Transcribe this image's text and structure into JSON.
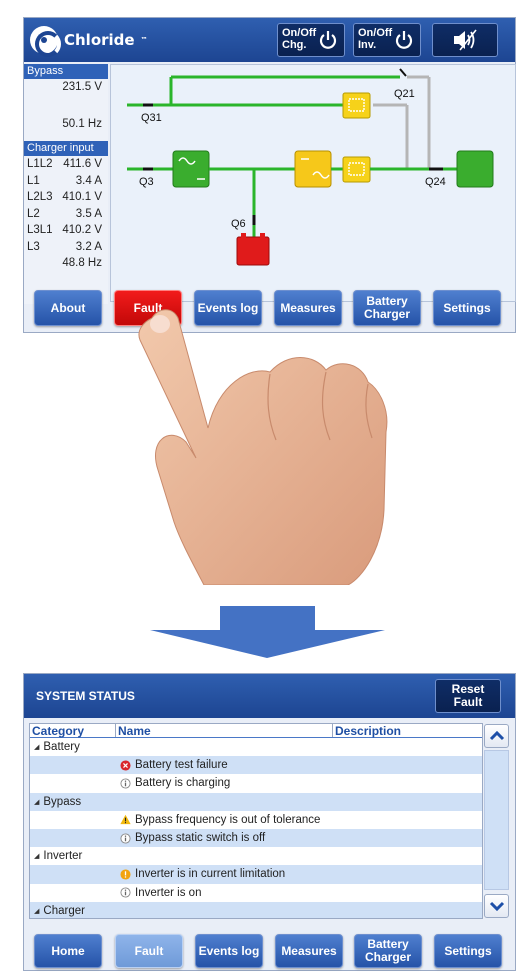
{
  "screen1": {
    "brand": "Chloride",
    "brand_tm": "™",
    "onoff_chg": "On/Off\nChg.",
    "onoff_chg_l1": "On/Off",
    "onoff_chg_l2": "Chg.",
    "onoff_inv_l1": "On/Off",
    "onoff_inv_l2": "Inv.",
    "bypass": {
      "header": "Bypass",
      "voltage": "231.5 V",
      "frequency": "50.1 Hz"
    },
    "charger_input": {
      "header": "Charger input",
      "rows": [
        {
          "label": "L1L2",
          "value": "411.6 V"
        },
        {
          "label": "L1",
          "value": "3.4 A"
        },
        {
          "label": "L2L3",
          "value": "410.1 V"
        },
        {
          "label": "L2",
          "value": "3.5 A"
        },
        {
          "label": "L3L1",
          "value": "410.2 V"
        },
        {
          "label": "L3",
          "value": "3.2 A"
        }
      ],
      "frequency": "48.8 Hz"
    },
    "diagram": {
      "q21": "Q21",
      "q31": "Q31",
      "q3": "Q3",
      "q24": "Q24",
      "q6": "Q6"
    },
    "nav": [
      "About",
      "Fault",
      "Events log",
      "Measures",
      "Battery Charger",
      "Settings"
    ]
  },
  "screen2": {
    "title": "SYSTEM STATUS",
    "reset_l1": "Reset",
    "reset_l2": "Fault",
    "columns": [
      "Category",
      "Name",
      "Description"
    ],
    "rows": [
      {
        "type": "category",
        "text": "Battery"
      },
      {
        "type": "item",
        "icon": "error",
        "text": "Battery test failure"
      },
      {
        "type": "item",
        "icon": "info",
        "text": "Battery is charging"
      },
      {
        "type": "category",
        "text": "Bypass"
      },
      {
        "type": "item",
        "icon": "warning",
        "text": "Bypass frequency is out of tolerance"
      },
      {
        "type": "item",
        "icon": "info",
        "text": "Bypass static switch is off"
      },
      {
        "type": "category",
        "text": "Inverter"
      },
      {
        "type": "item",
        "icon": "alert",
        "text": "Inverter is in current limitation"
      },
      {
        "type": "item",
        "icon": "info",
        "text": "Inverter is on"
      },
      {
        "type": "category",
        "text": "Charger"
      }
    ],
    "nav": [
      "Home",
      "Fault",
      "Events log",
      "Measures",
      "Battery Charger",
      "Settings"
    ]
  },
  "colors": {
    "header_blue": "#1d4592",
    "button_blue": "#2553a8",
    "fault_red": "#d40f0f",
    "bus_green": "#2bb52b",
    "bypass_grey": "#b5b5b5"
  }
}
